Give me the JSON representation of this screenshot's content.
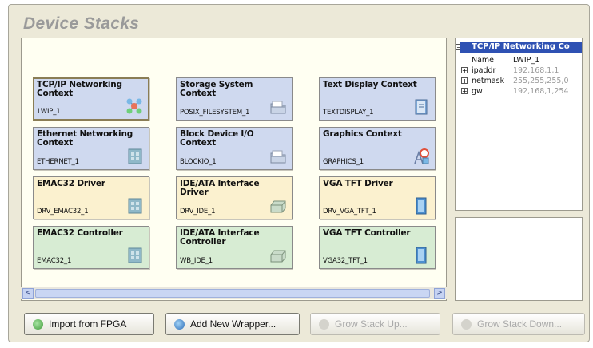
{
  "window": {
    "title": "Device Stacks"
  },
  "cards": [
    {
      "title": "TCP/IP Networking Context",
      "instance": "LWIP_1",
      "color": "blue",
      "icon": "network-icon",
      "selected": true
    },
    {
      "title": "Storage System Context",
      "instance": "POSIX_FILESYSTEM_1",
      "color": "blue",
      "icon": "folder-icon"
    },
    {
      "title": "Text Display Context",
      "instance": "TEXTDISPLAY_1",
      "color": "blue",
      "icon": "text-display-icon"
    },
    {
      "title": "Ethernet Networking Context",
      "instance": "ETHERNET_1",
      "color": "blue",
      "icon": "ethernet-icon"
    },
    {
      "title": "Block Device I/O Context",
      "instance": "BLOCKIO_1",
      "color": "blue",
      "icon": "folder-icon"
    },
    {
      "title": "Graphics Context",
      "instance": "GRAPHICS_1",
      "color": "blue",
      "icon": "graphics-shapes-icon"
    },
    {
      "title": "EMAC32 Driver",
      "instance": "DRV_EMAC32_1",
      "color": "yellow",
      "icon": "ethernet-icon"
    },
    {
      "title": "IDE/ATA Interface Driver",
      "instance": "DRV_IDE_1",
      "color": "yellow",
      "icon": "drive-icon"
    },
    {
      "title": "VGA TFT Driver",
      "instance": "DRV_VGA_TFT_1",
      "color": "yellow",
      "icon": "display-icon"
    },
    {
      "title": "EMAC32 Controller",
      "instance": "EMAC32_1",
      "color": "green",
      "icon": "ethernet-icon"
    },
    {
      "title": "IDE/ATA Interface Controller",
      "instance": "WB_IDE_1",
      "color": "green",
      "icon": "drive-icon"
    },
    {
      "title": "VGA TFT Controller",
      "instance": "VGA32_TFT_1",
      "color": "green",
      "icon": "display-icon"
    }
  ],
  "scrollbar": {
    "left_arrow": "<",
    "right_arrow": ">"
  },
  "properties": {
    "header": "TCP/IP Networking Co",
    "rows": [
      {
        "name": "Name",
        "value": "LWIP_1",
        "expandable": false,
        "dim": false
      },
      {
        "name": "ipaddr",
        "value": "192,168,1,1",
        "expandable": true,
        "dim": true
      },
      {
        "name": "netmask",
        "value": "255,255,255,0",
        "expandable": true,
        "dim": true
      },
      {
        "name": "gw",
        "value": "192,168,1,254",
        "expandable": true,
        "dim": true
      }
    ]
  },
  "buttons": [
    {
      "label": "Import from FPGA",
      "enabled": true,
      "icon": "import-icon"
    },
    {
      "label": "Add New Wrapper...",
      "enabled": true,
      "icon": "add-icon"
    },
    {
      "label": "Grow Stack Up...",
      "enabled": false,
      "icon": "grow-up-icon"
    },
    {
      "label": "Grow Stack Down...",
      "enabled": false,
      "icon": "grow-down-icon"
    }
  ],
  "colors": {
    "card_blue": "#cfd9ef",
    "card_yellow": "#fbf1cf",
    "card_green": "#d7ecd3",
    "selection_header": "#2e51b3",
    "title_gray": "#9a9a9a"
  }
}
